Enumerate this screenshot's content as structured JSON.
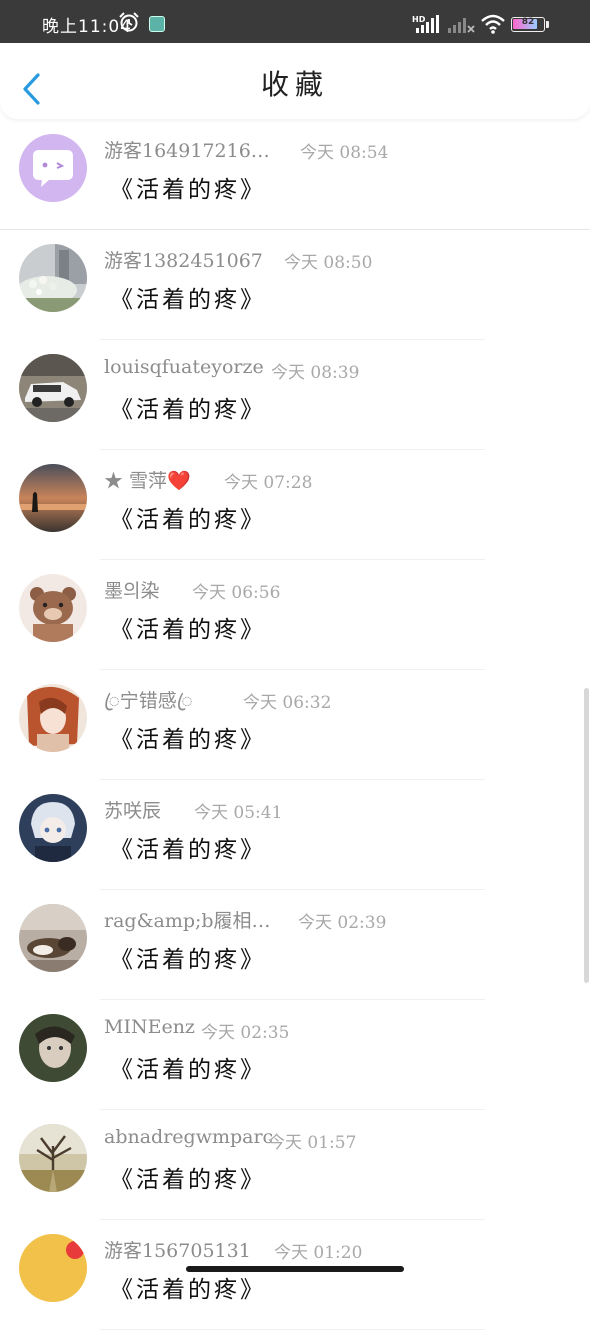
{
  "status_bar": {
    "time": "晚上11:04",
    "network_label": "HD",
    "battery": "82",
    "battery_level": 0.82
  },
  "header": {
    "title": "收藏",
    "back_icon": "chevron-left-icon"
  },
  "items": [
    {
      "name": "游客164917216…",
      "time": "今天 08:54",
      "book": "《活着的疼》",
      "avatar_icon": "chat-bubble-face-icon"
    },
    {
      "name": "游客1382451067",
      "time": "今天 08:50",
      "book": "《活着的疼》",
      "avatar_icon": "flowers-photo"
    },
    {
      "name": "louisqfuateyorze",
      "time": "今天 08:39",
      "book": "《活着的疼》",
      "avatar_icon": "white-car-photo"
    },
    {
      "name": "★ 雪萍❤️",
      "time": "今天 07:28",
      "book": "《活着的疼》",
      "avatar_icon": "sunset-silhouette-photo"
    },
    {
      "name": "墨의染",
      "time": "今天 06:56",
      "book": "《活着的疼》",
      "avatar_icon": "brown-bear-illustration"
    },
    {
      "name": "ꦿ宁错感ꦿ",
      "time": "今天 06:32",
      "book": "《活着的疼》",
      "avatar_icon": "anime-girl-illustration"
    },
    {
      "name": "苏咲辰",
      "time": "今天 05:41",
      "book": "《活着的疼》",
      "avatar_icon": "anime-boy-illustration"
    },
    {
      "name": "rag&amp;b履相…",
      "time": "今天 02:39",
      "book": "《活着的疼》",
      "avatar_icon": "sleeping-dog-photo"
    },
    {
      "name": "MINEenz",
      "time": "今天 02:35",
      "book": "《活着的疼》",
      "avatar_icon": "woman-portrait-photo"
    },
    {
      "name": "abnadregwmparc",
      "time": "今天 01:57",
      "book": "《活着的疼》",
      "avatar_icon": "autumn-tree-photo"
    },
    {
      "name": "游客156705131",
      "time": "今天 01:20",
      "book": "《活着的疼》",
      "avatar_icon": "yellow-avatar"
    }
  ]
}
